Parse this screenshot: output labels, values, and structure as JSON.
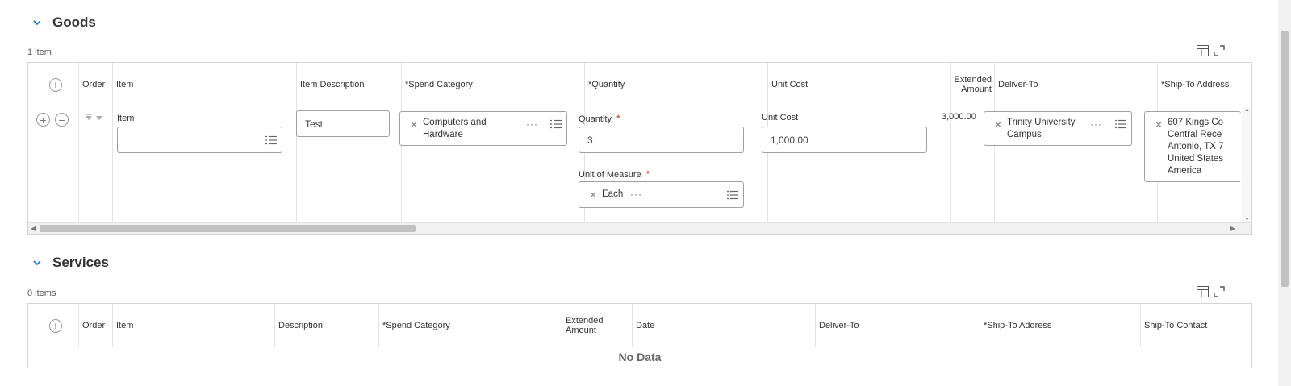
{
  "goods": {
    "title": "Goods",
    "count": "1 item",
    "headers": {
      "order": "Order",
      "item": "Item",
      "item_description": "Item Description",
      "spend_category": "*Spend Category",
      "quantity": "*Quantity",
      "unit_cost": "Unit Cost",
      "extended_amount_1": "Extended",
      "extended_amount_2": "Amount",
      "deliver_to": "Deliver-To",
      "ship_to_address": "*Ship-To Address"
    },
    "row": {
      "item_label": "Item",
      "item_value": "",
      "description_value": "Test",
      "spend_category_line1": "Computers and",
      "spend_category_line2": "Hardware",
      "quantity_label": "Quantity",
      "quantity_value": "3",
      "uom_label": "Unit of Measure",
      "uom_value": "Each",
      "unit_cost_label": "Unit Cost",
      "unit_cost_value": "1,000.00",
      "extended_amount": "3,000.00",
      "deliver_to_line1": "Trinity University",
      "deliver_to_line2": "Campus",
      "ship_to_lines": [
        "607 Kings Co",
        "Central Rece",
        "Antonio, TX 7",
        "United States",
        "America"
      ],
      "required_mark": "*",
      "more_dots": "···"
    }
  },
  "services": {
    "title": "Services",
    "count": "0 items",
    "headers": {
      "order": "Order",
      "item": "Item",
      "description": "Description",
      "spend_category": "*Spend Category",
      "extended_amount_1": "Extended",
      "extended_amount_2": "Amount",
      "date": "Date",
      "deliver_to": "Deliver-To",
      "ship_to_address": "*Ship-To Address",
      "ship_to_contact": "Ship-To Contact"
    },
    "empty_text": "No Data"
  },
  "icons": {
    "collapse": "chevron-down-icon",
    "add": "plus-circle-icon",
    "remove": "minus-circle-icon",
    "clear": "x-icon",
    "prompt": "list-icon",
    "view": "table-layout-icon",
    "expand": "fullscreen-icon"
  },
  "colors": {
    "chevron": "#0875e1",
    "required": "#d0271d",
    "border": "#d4d4d4"
  }
}
